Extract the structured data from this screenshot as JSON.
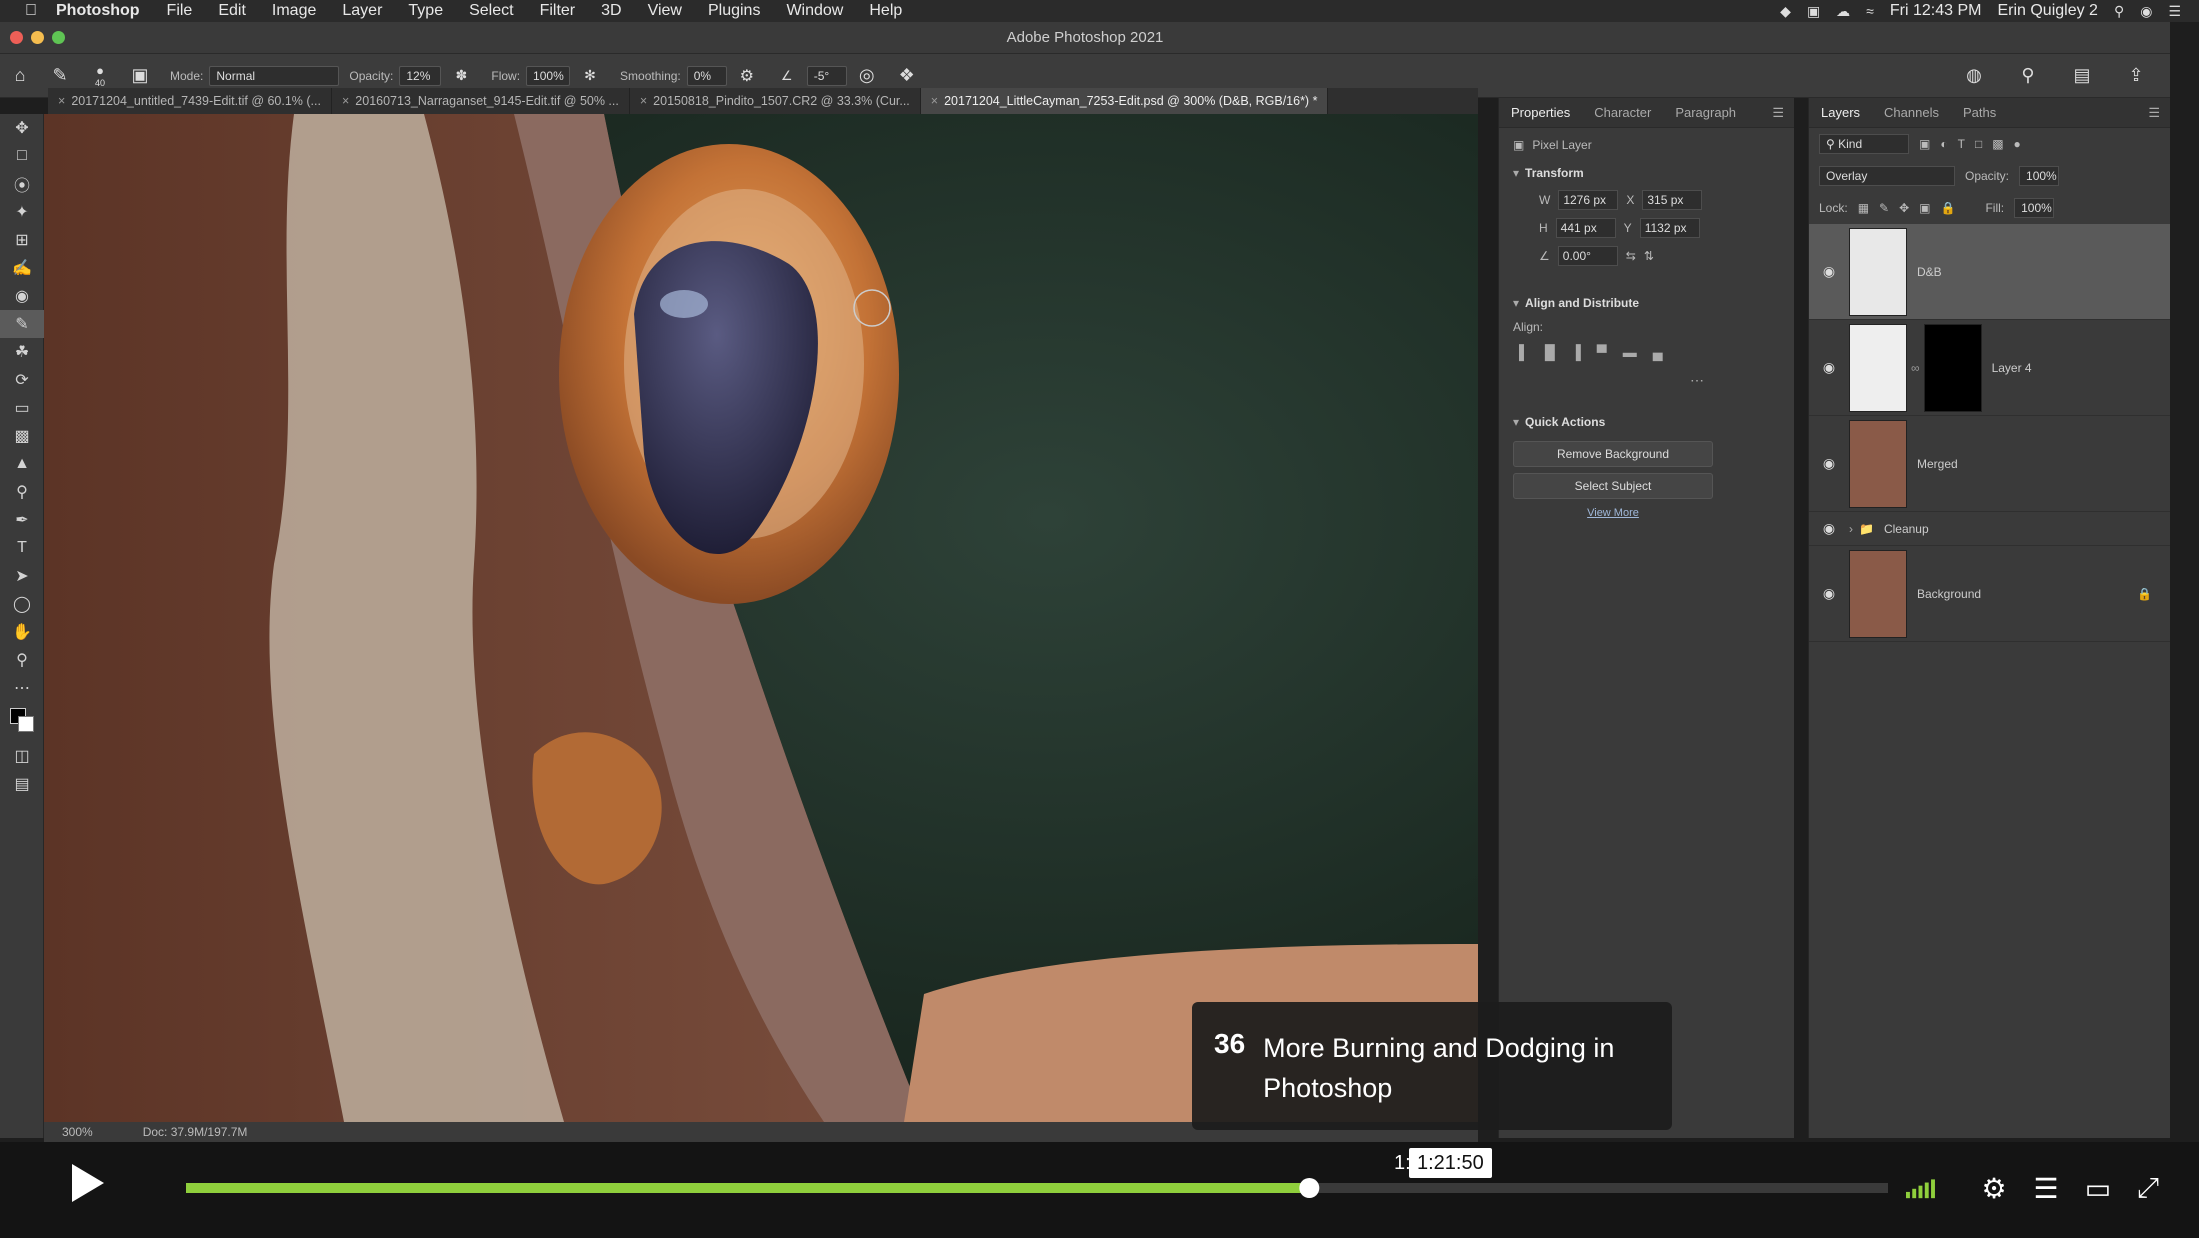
{
  "menubar": {
    "app_name": "Photoshop",
    "items": [
      "File",
      "Edit",
      "Image",
      "Layer",
      "Type",
      "Select",
      "Filter",
      "3D",
      "View",
      "Plugins",
      "Window",
      "Help"
    ],
    "clock": "Fri 12:43 PM",
    "user": "Erin Quigley 2"
  },
  "window": {
    "title": "Adobe Photoshop 2021"
  },
  "options": {
    "mode_label": "Mode:",
    "mode_value": "Normal",
    "opacity_label": "Opacity:",
    "opacity_value": "12%",
    "flow_label": "Flow:",
    "flow_value": "100%",
    "smoothing_label": "Smoothing:",
    "smoothing_value": "0%",
    "angle_value": "-5°",
    "brush_size": "40"
  },
  "tabs": [
    {
      "label": "20171204_untitled_7439-Edit.tif @ 60.1% (..."
    },
    {
      "label": "20160713_Narraganset_9145-Edit.tif @ 50% ..."
    },
    {
      "label": "20150818_Pindito_1507.CR2 @ 33.3% (Cur..."
    },
    {
      "label": "20171204_LittleCayman_7253-Edit.psd @ 300% (D&B, RGB/16*) *"
    }
  ],
  "status": {
    "zoom": "300%",
    "doc": "Doc: 37.9M/197.7M"
  },
  "properties": {
    "tabs": [
      "Properties",
      "Character",
      "Paragraph"
    ],
    "layer_kind": "Pixel Layer",
    "transform_title": "Transform",
    "w_label": "W",
    "w_value": "1276 px",
    "x_label": "X",
    "x_value": "315 px",
    "h_label": "H",
    "h_value": "441 px",
    "y_label": "Y",
    "y_value": "1132 px",
    "angle_value": "0.00°",
    "align_title": "Align and Distribute",
    "align_label": "Align:",
    "quick_title": "Quick Actions",
    "remove_bg": "Remove Background",
    "select_subject": "Select Subject",
    "view_more": "View More"
  },
  "layers_panel": {
    "tabs": [
      "Layers",
      "Channels",
      "Paths"
    ],
    "kind": "Kind",
    "blend_mode": "Overlay",
    "opacity_label": "Opacity:",
    "opacity_value": "100%",
    "lock_label": "Lock:",
    "fill_label": "Fill:",
    "fill_value": "100%",
    "layers": [
      {
        "name": "D&B"
      },
      {
        "name": "Layer 4"
      },
      {
        "name": "Merged"
      },
      {
        "name": "Cleanup"
      },
      {
        "name": "Background"
      }
    ]
  },
  "lesson": {
    "number": "36",
    "title": "More Burning and Dodging in Photoshop"
  },
  "player": {
    "time_prefix": "1:",
    "time_tooltip": "1:21:50",
    "played_fraction": 0.66,
    "accent": "#8fcf3c"
  }
}
